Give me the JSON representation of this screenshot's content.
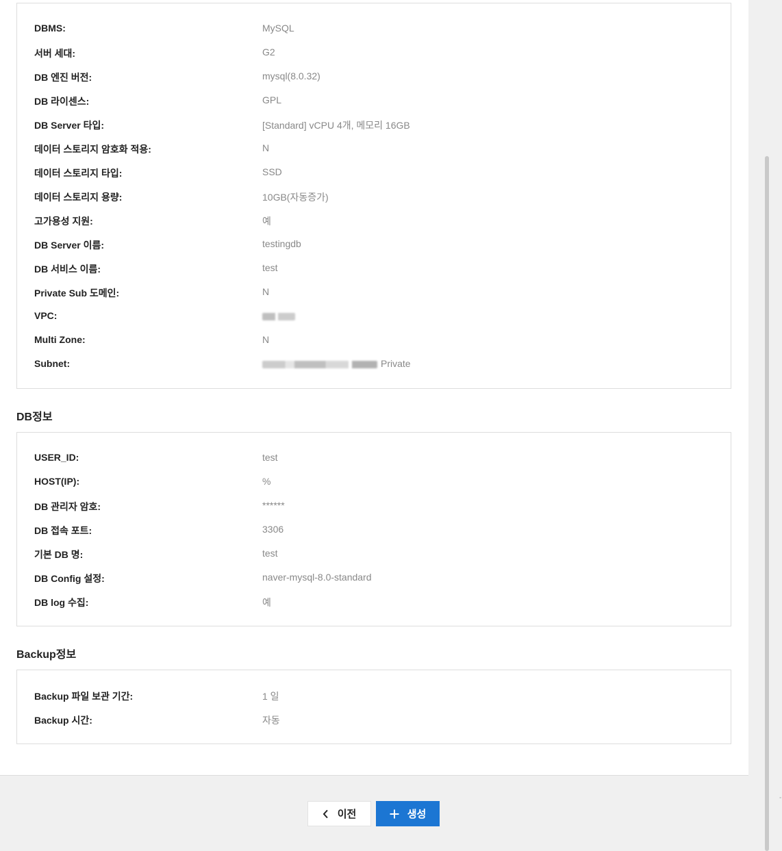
{
  "server_info": {
    "rows": [
      {
        "label": "DBMS:",
        "value": "MySQL"
      },
      {
        "label": "서버 세대:",
        "value": "G2"
      },
      {
        "label": "DB 엔진 버전:",
        "value": "mysql(8.0.32)"
      },
      {
        "label": "DB 라이센스:",
        "value": "GPL"
      },
      {
        "label": "DB Server 타입:",
        "value": "[Standard] vCPU 4개, 메모리 16GB"
      },
      {
        "label": "데이터 스토리지 암호화 적용:",
        "value": "N"
      },
      {
        "label": "데이터 스토리지 타입:",
        "value": "SSD"
      },
      {
        "label": "데이터 스토리지 용량:",
        "value": "10GB(자동증가)"
      },
      {
        "label": "고가용성 지원:",
        "value": "예"
      },
      {
        "label": "DB Server 이름:",
        "value": "testingdb"
      },
      {
        "label": "DB 서비스 이름:",
        "value": "test"
      },
      {
        "label": "Private Sub 도메인:",
        "value": "N"
      },
      {
        "label": "VPC:",
        "value": ""
      },
      {
        "label": "Multi Zone:",
        "value": "N"
      },
      {
        "label": "Subnet:",
        "value": "Private"
      }
    ]
  },
  "db_info": {
    "title": "DB정보",
    "rows": [
      {
        "label": "USER_ID:",
        "value": "test"
      },
      {
        "label": "HOST(IP):",
        "value": "%"
      },
      {
        "label": "DB 관리자 암호:",
        "value": "******"
      },
      {
        "label": "DB 접속 포트:",
        "value": "3306"
      },
      {
        "label": "기본 DB 명:",
        "value": "test"
      },
      {
        "label": "DB Config 설정:",
        "value": "naver-mysql-8.0-standard"
      },
      {
        "label": "DB log 수집:",
        "value": "예"
      }
    ]
  },
  "backup_info": {
    "title": "Backup정보",
    "rows": [
      {
        "label": "Backup 파일 보관 기간:",
        "value": "1 일"
      },
      {
        "label": "Backup 시간:",
        "value": "자동"
      }
    ]
  },
  "buttons": {
    "prev_label": "이전",
    "create_label": "생성",
    "create_color": "#1c76d3"
  }
}
